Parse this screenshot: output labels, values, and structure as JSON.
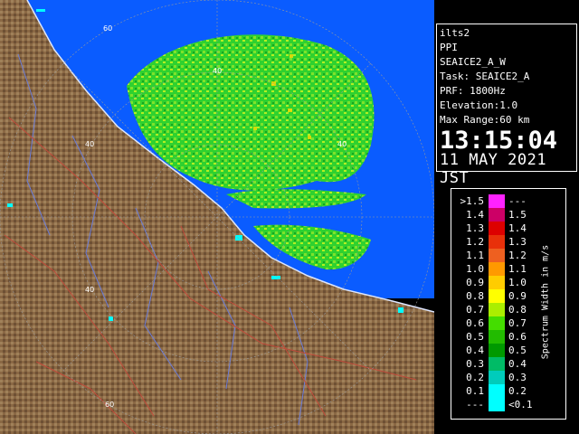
{
  "info": {
    "radar": "ilts2",
    "mode": "PPI",
    "product": "SEAICE2_A_W",
    "task": "Task: SEAICE2_A",
    "prf": "PRF: 1800Hz",
    "elevation": "Elevation:1.0",
    "max_range": "Max Range:60 km",
    "time": "13:15:04",
    "date": "11 MAY 2021 JST"
  },
  "legend": {
    "title": "Spectrum Width in m/s",
    "rows": [
      {
        "lo": ">1.5",
        "hi": "---",
        "color": "#ff22ff"
      },
      {
        "lo": "1.4",
        "hi": "1.5",
        "color": "#cc0066"
      },
      {
        "lo": "1.3",
        "hi": "1.4",
        "color": "#dd0000"
      },
      {
        "lo": "1.2",
        "hi": "1.3",
        "color": "#e8300a"
      },
      {
        "lo": "1.1",
        "hi": "1.2",
        "color": "#ee6020"
      },
      {
        "lo": "1.0",
        "hi": "1.1",
        "color": "#ff9900"
      },
      {
        "lo": "0.9",
        "hi": "1.0",
        "color": "#ffcc00"
      },
      {
        "lo": "0.8",
        "hi": "0.9",
        "color": "#ffff00"
      },
      {
        "lo": "0.7",
        "hi": "0.8",
        "color": "#aaee00"
      },
      {
        "lo": "0.6",
        "hi": "0.7",
        "color": "#44dd00"
      },
      {
        "lo": "0.5",
        "hi": "0.6",
        "color": "#22bb00"
      },
      {
        "lo": "0.4",
        "hi": "0.5",
        "color": "#009900"
      },
      {
        "lo": "0.3",
        "hi": "0.4",
        "color": "#00bb66"
      },
      {
        "lo": "0.2",
        "hi": "0.3",
        "color": "#00ccbb"
      },
      {
        "lo": "0.1",
        "hi": "0.2",
        "color": "#00ffff"
      },
      {
        "lo": "---",
        "hi": "<0.1",
        "color": "#00ffff"
      }
    ]
  },
  "map": {
    "range_ring_labels": [
      "60",
      "40",
      "40",
      "40",
      "40",
      "60"
    ],
    "colors": {
      "sea": "#0a5cff",
      "land": "#8c6a45",
      "echo": "#22cc22",
      "grid": "#999999"
    }
  }
}
